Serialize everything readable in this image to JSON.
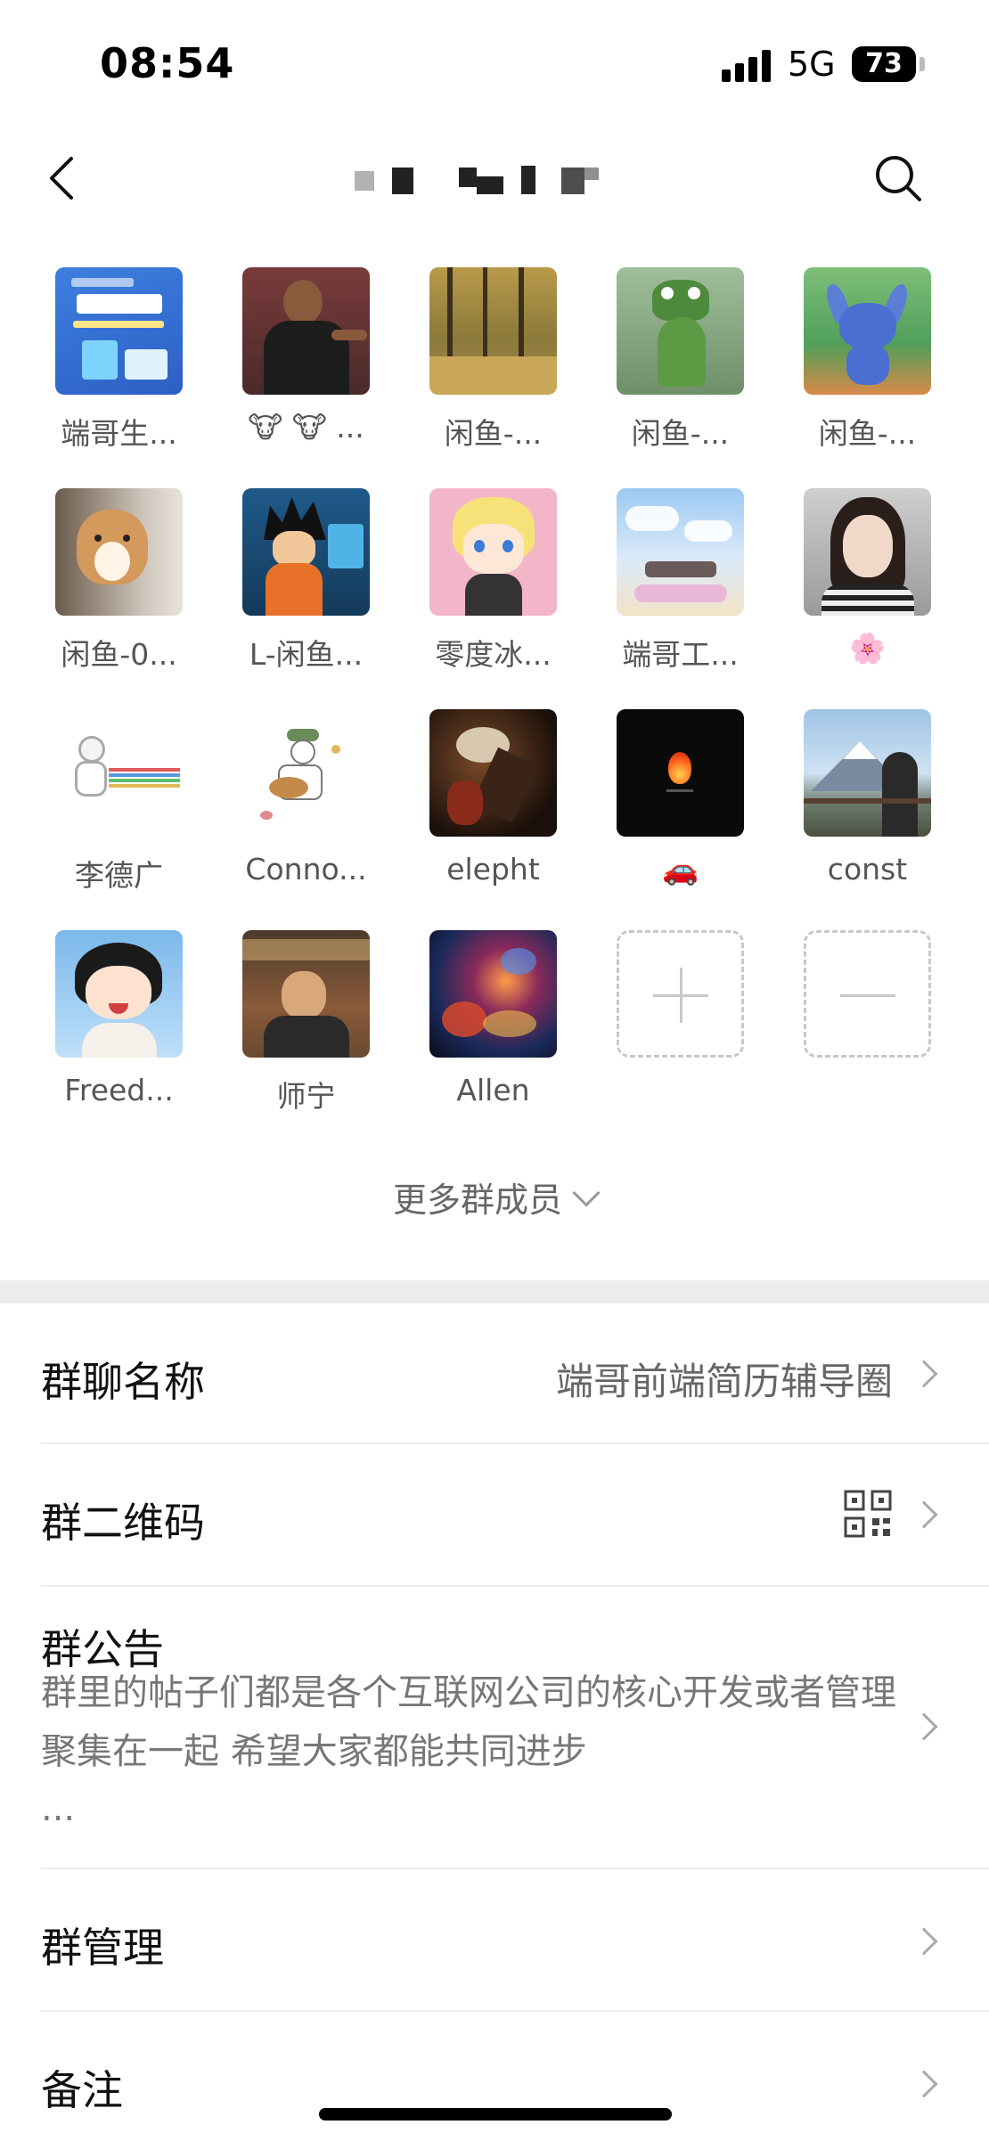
{
  "status_bar": {
    "time": "08:54",
    "network": "5G",
    "battery": "73"
  },
  "nav": {
    "back_icon": "chevron-left-icon",
    "search_icon": "search-icon"
  },
  "members": [
    {
      "name": "端哥生...",
      "avatar": "software-dev-banner"
    },
    {
      "name": "🐮 🐮 ...",
      "avatar": "soccer-player-photo"
    },
    {
      "name": "闲鱼-...",
      "avatar": "autumn-trees-photo"
    },
    {
      "name": "闲鱼-...",
      "avatar": "cartoon-crocodile"
    },
    {
      "name": "闲鱼-...",
      "avatar": "stitch-cartoon"
    },
    {
      "name": "闲鱼-0...",
      "avatar": "corgi-dog-photo"
    },
    {
      "name": "L-闲鱼...",
      "avatar": "goku-at-computer"
    },
    {
      "name": "零度冰...",
      "avatar": "anime-blonde-boy"
    },
    {
      "name": "端哥工...",
      "avatar": "piano-in-clouds"
    },
    {
      "name": "🌸",
      "avatar": "girl-portrait"
    },
    {
      "name": "李德广",
      "avatar": "ultraman-sketch"
    },
    {
      "name": "Conno...",
      "avatar": "guitar-sketch"
    },
    {
      "name": "elepht",
      "avatar": "dark-bird-art"
    },
    {
      "name": "🚗",
      "avatar": "fire-on-black"
    },
    {
      "name": "const",
      "avatar": "mount-fuji-photo"
    },
    {
      "name": "Freed...",
      "avatar": "anime-child-with-cat"
    },
    {
      "name": "师宁",
      "avatar": "man-on-train-photo"
    },
    {
      "name": "Allen",
      "avatar": "abstract-painting"
    }
  ],
  "add_member": {
    "icon": "plus-icon"
  },
  "remove_member": {
    "icon": "minus-icon"
  },
  "more_members": "更多群成员",
  "settings": {
    "group_name": {
      "label": "群聊名称",
      "value": "端哥前端简历辅导圈"
    },
    "qr_code": {
      "label": "群二维码",
      "icon": "qr-code-icon"
    },
    "notice": {
      "label": "群公告",
      "text": "群里的帖子们都是各个互联网公司的核心开发或者管理 聚集在一起 希望大家都能共同进步",
      "more": "..."
    },
    "manage": {
      "label": "群管理"
    },
    "remark": {
      "label": "备注"
    }
  },
  "colors": {
    "background": "#ffffff",
    "separator": "#ededed",
    "text_primary": "#111111",
    "text_secondary": "#666666",
    "dashed_border": "#c8c8c8"
  }
}
